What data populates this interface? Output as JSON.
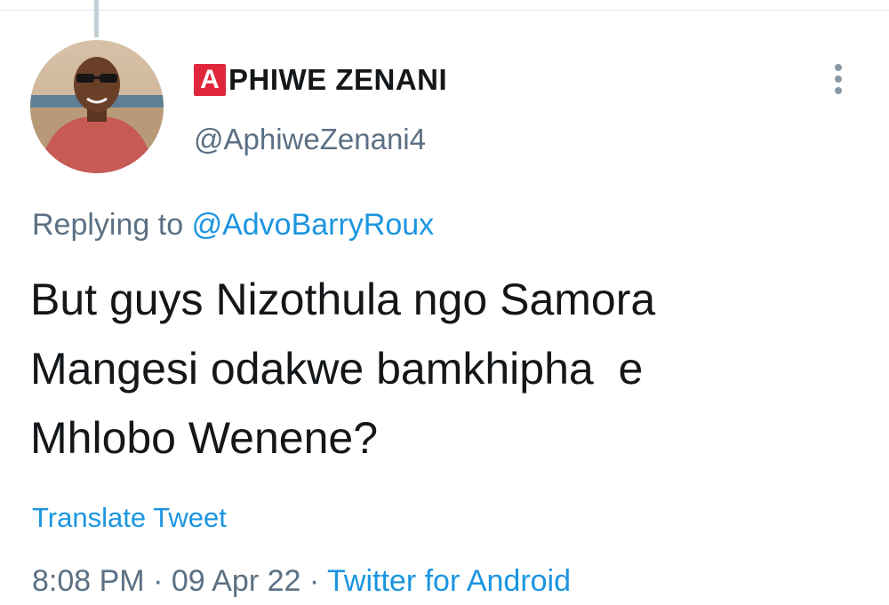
{
  "author": {
    "badge_letter": "A",
    "display_name_rest": "PHIWE ZENANI",
    "handle": "@AphiweZenani4"
  },
  "reply": {
    "prefix": "Replying to",
    "mention": "@AdvoBarryRoux"
  },
  "tweet": {
    "text": "But guys Nizothula ngo Samora\nMangesi odakwe bamkhipha  e\nMhlobo Wenene?"
  },
  "actions": {
    "translate_label": "Translate Tweet"
  },
  "meta": {
    "time": "8:08 PM",
    "sep1": " · ",
    "date": "09 Apr 22",
    "sep2": " · ",
    "source": "Twitter for Android"
  },
  "colors": {
    "link": "#1b95e0",
    "secondary_text": "#5b7083",
    "badge": "#e0263a"
  }
}
